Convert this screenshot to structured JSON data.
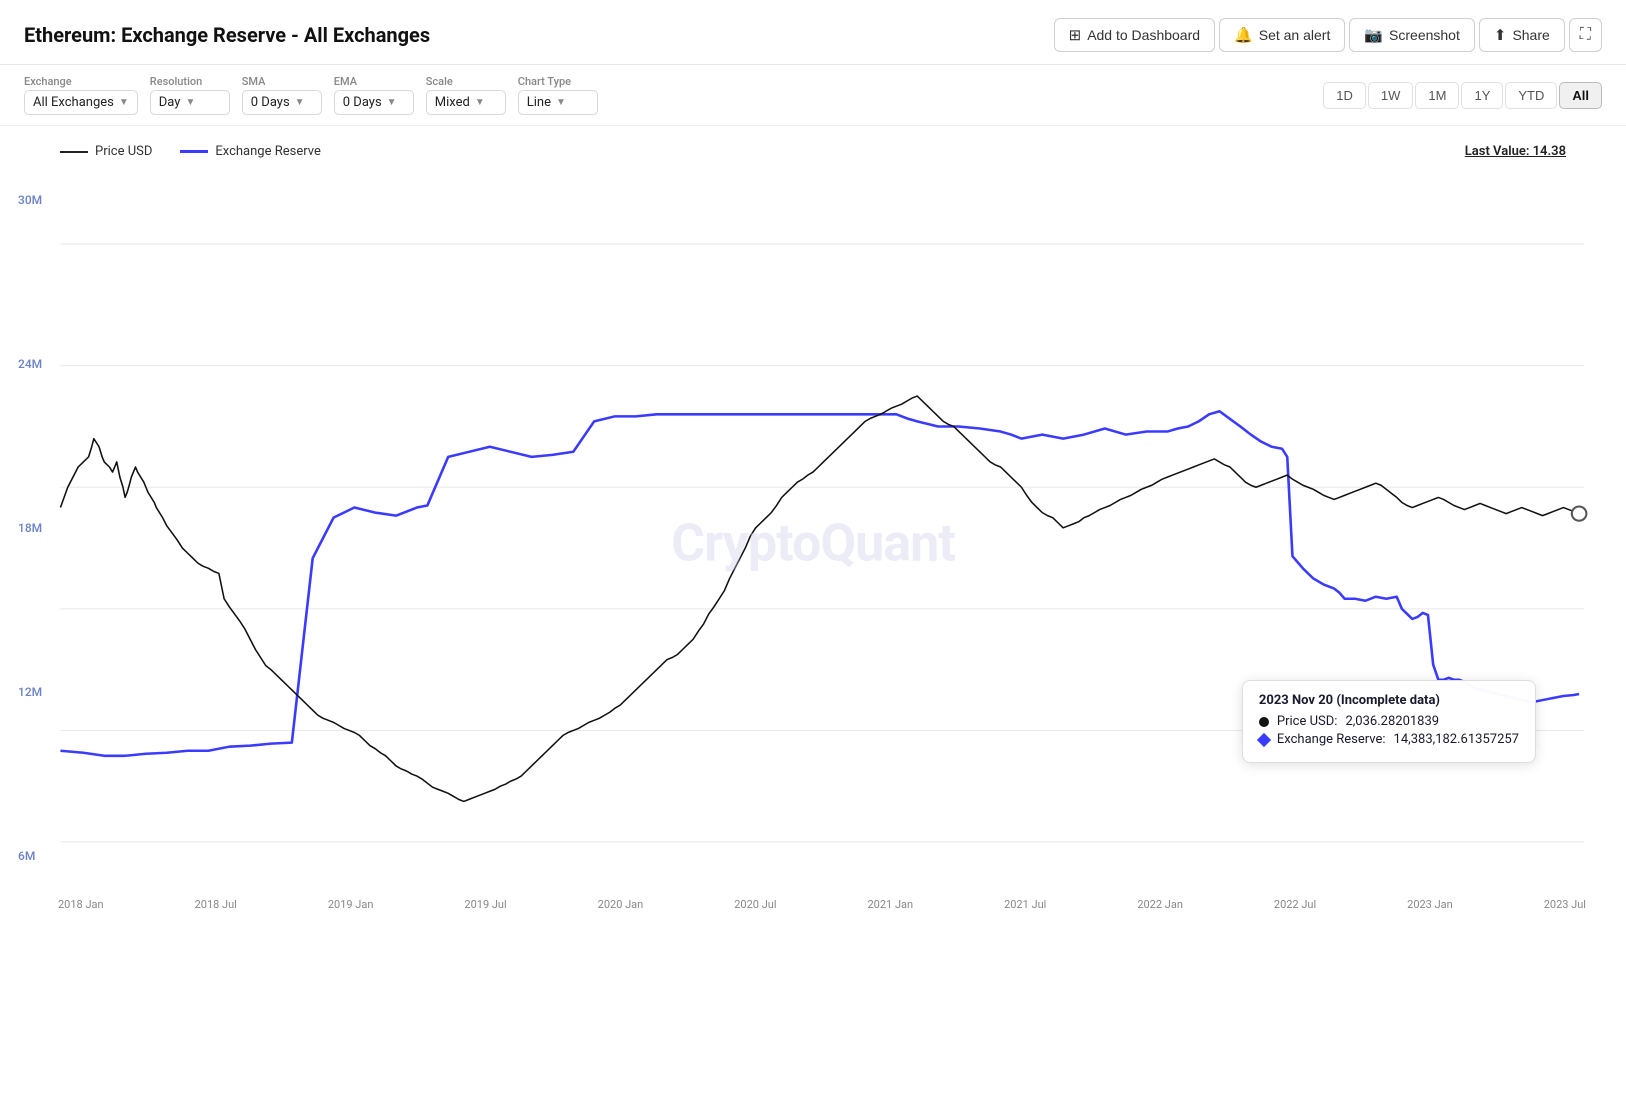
{
  "header": {
    "title": "Ethereum: Exchange Reserve - All Exchanges",
    "actions": [
      {
        "id": "add-dashboard",
        "label": "Add to Dashboard",
        "icon": "⊞"
      },
      {
        "id": "set-alert",
        "label": "Set an alert",
        "icon": "🔔"
      },
      {
        "id": "screenshot",
        "label": "Screenshot",
        "icon": "📷"
      },
      {
        "id": "share",
        "label": "Share",
        "icon": "⬆"
      }
    ],
    "expand_icon": "⛶"
  },
  "controls": {
    "exchange": {
      "label": "Exchange",
      "value": "All Exchanges"
    },
    "resolution": {
      "label": "Resolution",
      "value": "Day"
    },
    "sma": {
      "label": "SMA",
      "value": "0 Days"
    },
    "ema": {
      "label": "EMA",
      "value": "0 Days"
    },
    "scale": {
      "label": "Scale",
      "value": "Mixed"
    },
    "chart_type": {
      "label": "Chart Type",
      "value": "Line"
    }
  },
  "time_range": {
    "buttons": [
      "1D",
      "1W",
      "1M",
      "1Y",
      "YTD",
      "All"
    ],
    "active": "All"
  },
  "legend": {
    "price_label": "Price USD",
    "reserve_label": "Exchange Reserve",
    "last_value_label": "Last Value: 14.38"
  },
  "watermark": "CryptoQuant",
  "tooltip": {
    "date": "2023 Nov 20 (Incomplete data)",
    "price_label": "Price USD:",
    "price_value": "2,036.28201839",
    "reserve_label": "Exchange Reserve:",
    "reserve_value": "14,383,182.61357257"
  },
  "y_axis": {
    "labels": [
      "30M",
      "24M",
      "18M",
      "12M",
      "6M"
    ]
  },
  "x_axis": {
    "labels": [
      "2018 Jan",
      "2018 Jul",
      "2019 Jan",
      "2019 Jul",
      "2020 Jan",
      "2020 Jul",
      "2021 Jan",
      "2021 Jul",
      "2022 Jan",
      "2022 Jul",
      "2023 Jan",
      "2023 Jul"
    ]
  },
  "chart": {
    "blue_line_description": "Exchange Reserve line - rises sharply 2019, peaks 2020, declines from 2021",
    "black_line_description": "Price USD line - volatile, peaks 2021, current ~2036"
  }
}
